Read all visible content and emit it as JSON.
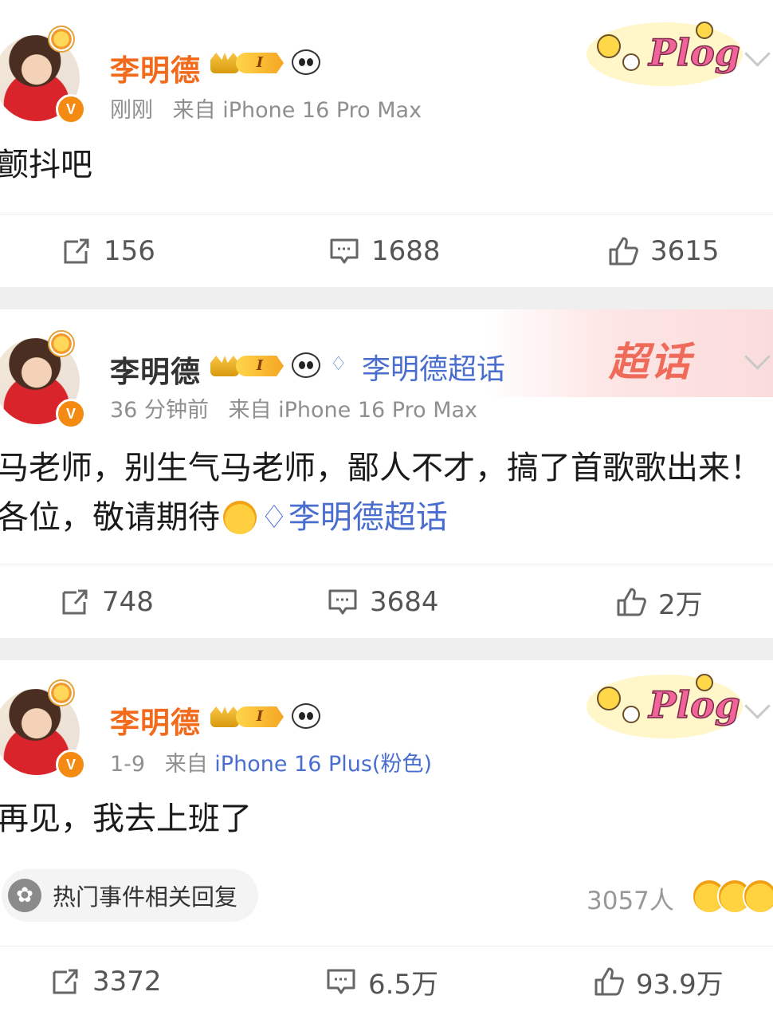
{
  "posts": [
    {
      "author": "李明德",
      "level_badge": "I",
      "time": "刚刚",
      "source_prefix": "来自",
      "source": "iPhone 16 Pro Max",
      "content": "颤抖吧",
      "decoration": "Plog",
      "actions": {
        "repost": "156",
        "comment": "1688",
        "like": "3615"
      }
    },
    {
      "author": "李明德",
      "level_badge": "I",
      "topic": "李明德超话",
      "time": "36 分钟前",
      "source_prefix": "来自",
      "source": "iPhone 16 Pro Max",
      "content": "马老师，别生气马老师，鄙人不才，搞了首歌歌出来！各位，敬请期待",
      "content_topic": "李明德超话",
      "decoration": "超话",
      "actions": {
        "repost": "748",
        "comment": "3684",
        "like": "2万"
      }
    },
    {
      "author": "李明德",
      "level_badge": "I",
      "time": "1-9",
      "source_prefix": "来自",
      "source": "iPhone 16 Plus(粉色)",
      "content": "再见，我去上班了",
      "decoration": "Plog",
      "hot_reply_label": "热门事件相关回复",
      "reaction_count": "3057人",
      "actions": {
        "repost": "3372",
        "comment": "6.5万",
        "like": "93.9万"
      }
    }
  ],
  "colors": {
    "name_orange": "#f26b1d",
    "link_blue": "#4a6ed0",
    "meta_gray": "#8f8f8f",
    "page_bg": "#efefef"
  },
  "icons": [
    "repost-icon",
    "comment-icon",
    "like-icon",
    "verified-icon",
    "crown-icon",
    "panda-icon",
    "chevron-down-icon",
    "topic-diamond-icon",
    "hot-event-icon"
  ]
}
